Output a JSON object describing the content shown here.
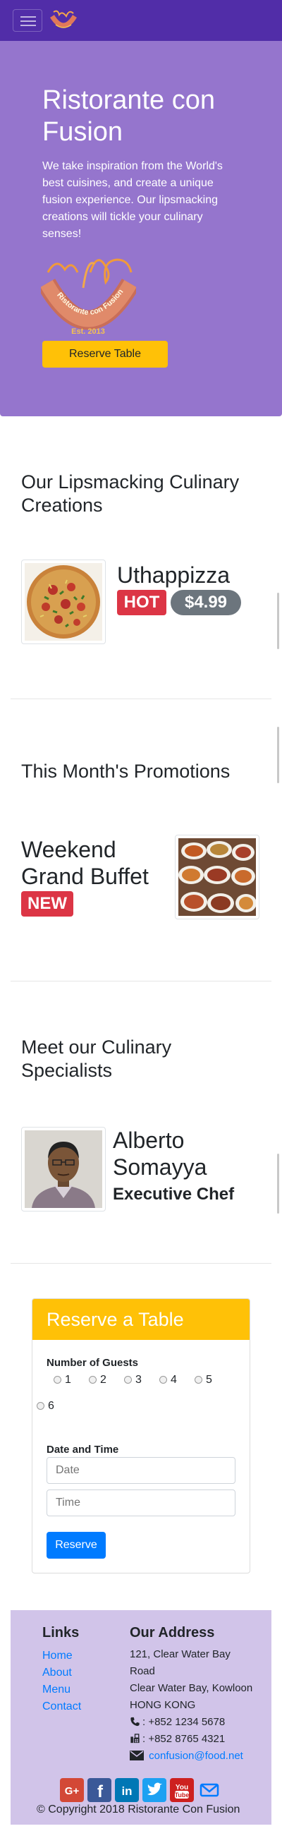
{
  "navbar": {
    "toggler": "hamburger-menu"
  },
  "jumbotron": {
    "title": "Ristorante con Fusion",
    "text": "We take inspiration from the World's best cuisines, and create a unique fusion experience. Our lipsmacking creations will tickle your culinary senses!",
    "logo_text": "Ristorante con Fusion",
    "logo_year": "Est. 2013",
    "reserve_button": "Reserve Table"
  },
  "creations": {
    "title": "Our Lipsmacking Culinary Creations",
    "dish_name": "Uthappizza",
    "hot_badge": "HOT",
    "price_badge": "$4.99"
  },
  "promotions": {
    "title": "This Month's Promotions",
    "name": "Weekend Grand Buffet",
    "new_badge": "NEW"
  },
  "specialists": {
    "title": "Meet our Culinary Specialists",
    "name": "Alberto Somayya",
    "role": "Executive Chef"
  },
  "reserve": {
    "title": "Reserve a Table",
    "guests_label": "Number of Guests",
    "guest_options": [
      "1",
      "2",
      "3",
      "4",
      "5",
      "6"
    ],
    "datetime_label": "Date and Time",
    "date_placeholder": "Date",
    "time_placeholder": "Time",
    "submit": "Reserve"
  },
  "footer": {
    "links_title": "Links",
    "links": [
      "Home",
      "About",
      "Menu",
      "Contact"
    ],
    "address_title": "Our Address",
    "address_lines": [
      "121, Clear Water Bay",
      "Road",
      "Clear Water Bay, Kowloon",
      "HONG KONG"
    ],
    "phone": ": +852 1234 5678",
    "fax": ": +852 8765 4321",
    "email": "confusion@food.net",
    "social_icons": [
      "google-plus-icon",
      "facebook-icon",
      "linkedin-icon",
      "twitter-icon",
      "youtube-icon",
      "mail-icon"
    ],
    "copyright": "© Copyright 2018 Ristorante Con Fusion"
  },
  "colors": {
    "primary_dark": "#512DA8",
    "jumbotron": "#9575CD",
    "footer": "#D1C4E9",
    "warning": "#FFC107",
    "danger": "#dc3545",
    "primary_button": "#007bff"
  }
}
